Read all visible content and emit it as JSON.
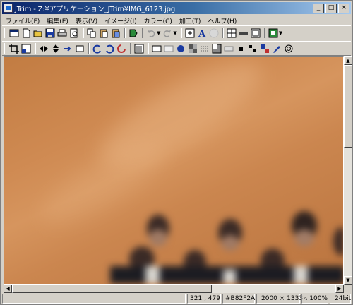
{
  "window": {
    "title": "JTrim - Z:¥アプリケーション_JTrim¥IMG_6123.jpg",
    "minimize_glyph": "_",
    "maximize_glyph": "□",
    "close_glyph": "×"
  },
  "menu": [
    {
      "label": "ファイル(F)"
    },
    {
      "label": "編集(E)"
    },
    {
      "label": "表示(V)"
    },
    {
      "label": "イメージ(I)"
    },
    {
      "label": "カラー(C)"
    },
    {
      "label": "加工(T)"
    },
    {
      "label": "ヘルプ(H)"
    }
  ],
  "toolbar_icons": {
    "row1": [
      "new-window",
      "new-file",
      "open-folder",
      "save",
      "print",
      "print-preview",
      "copy",
      "paste",
      "paste-new",
      "undo-history",
      "undo",
      "redo",
      "fit-window",
      "text",
      "circle",
      "grid",
      "bar",
      "frame"
    ],
    "row2": [
      "crop",
      "resize",
      "flip-horizontal",
      "flip-vertical",
      "rotate-free",
      "rotate-square",
      "rotate-left",
      "rotate-right",
      "color-invert",
      "layer",
      "rect-select",
      "circle-select",
      "mosaic",
      "emboss",
      "grayscale",
      "diff",
      "sharpen",
      "bucket",
      "pen",
      "spiral"
    ],
    "row3": [
      "brightness",
      "contrast",
      "gamma",
      "rgb",
      "hsv",
      "histogram",
      "tone-curve",
      "hue",
      "pattern",
      "noise",
      "channels",
      "posterize",
      "magnifier",
      "zoom-in",
      "zoom-out",
      "eyedropper"
    ]
  },
  "colors": {
    "titlebar_start": "#0a246a",
    "titlebar_end": "#a6caf0",
    "chrome": "#d4d0c8"
  },
  "statusbar": {
    "coordinates": "321 , 479",
    "color_hex": "#B82F2A",
    "image_size": "2000 × 1333",
    "zoom": "100%",
    "depth": "24bit"
  },
  "canvas": {
    "image_description_icon": "photo-canvas"
  }
}
